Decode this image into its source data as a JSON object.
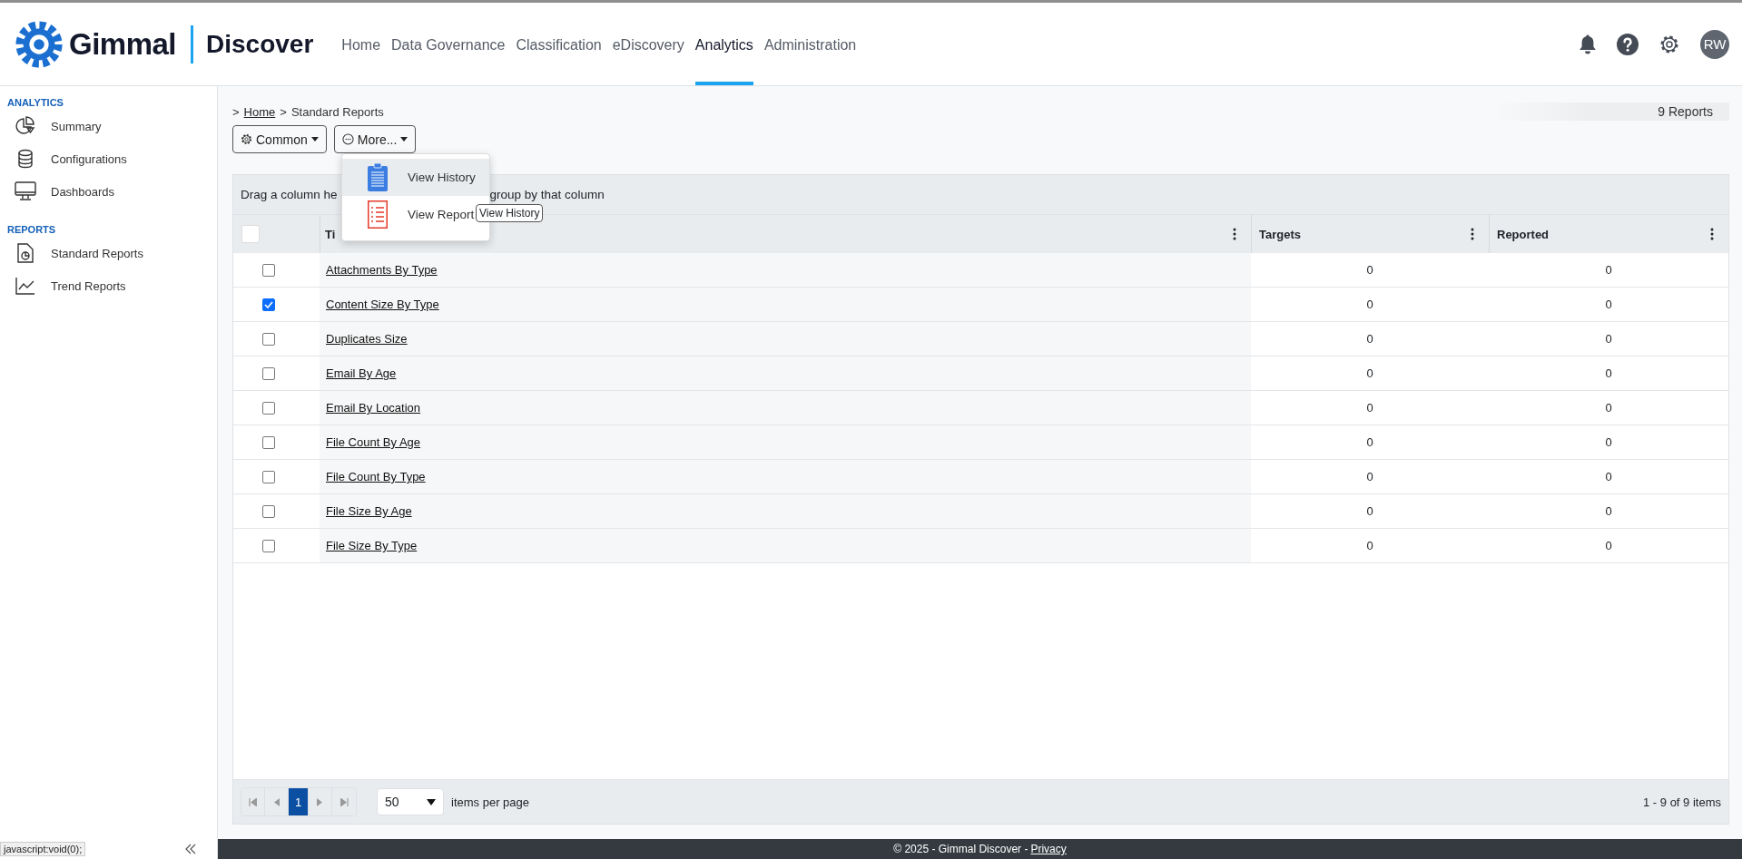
{
  "header": {
    "brand": "Gimmal",
    "product": "Discover",
    "avatar": "RW"
  },
  "nav": [
    {
      "label": "Home",
      "selected": false
    },
    {
      "label": "Data Governance",
      "selected": false
    },
    {
      "label": "Classification",
      "selected": false
    },
    {
      "label": "eDiscovery",
      "selected": false
    },
    {
      "label": "Analytics",
      "selected": true
    },
    {
      "label": "Administration",
      "selected": false
    }
  ],
  "sidebar": {
    "sections": [
      {
        "title": "ANALYTICS",
        "items": [
          {
            "label": "Summary"
          },
          {
            "label": "Configurations"
          },
          {
            "label": "Dashboards"
          }
        ]
      },
      {
        "title": "REPORTS",
        "items": [
          {
            "label": "Standard Reports"
          },
          {
            "label": "Trend Reports"
          }
        ]
      }
    ]
  },
  "breadcrumb": [
    {
      "separator": ">",
      "label": "Home",
      "link": true
    },
    {
      "separator": ">",
      "label": "Standard Reports",
      "link": false
    }
  ],
  "report_count": "9 Reports",
  "toolbar": [
    {
      "label": "Common"
    },
    {
      "label": "More..."
    }
  ],
  "menu": {
    "items": [
      {
        "label": "View History",
        "selected": true
      },
      {
        "label": "View Report",
        "selected": false
      }
    ],
    "tooltip": "View History"
  },
  "grid": {
    "group_hint": [
      "Drag a column he",
      "group by that column"
    ],
    "header_checked": false,
    "columns": [
      {
        "label": "Ti"
      },
      {
        "label": "Targets"
      },
      {
        "label": "Reported"
      }
    ],
    "rows": [
      {
        "title": "Attachments By Type",
        "targets": "0",
        "reported": "0",
        "checked": false
      },
      {
        "title": "Content Size By Type",
        "targets": "0",
        "reported": "0",
        "checked": true
      },
      {
        "title": "Duplicates Size",
        "targets": "0",
        "reported": "0",
        "checked": false
      },
      {
        "title": "Email By Age",
        "targets": "0",
        "reported": "0",
        "checked": false
      },
      {
        "title": "Email By Location",
        "targets": "0",
        "reported": "0",
        "checked": false
      },
      {
        "title": "File Count By Age",
        "targets": "0",
        "reported": "0",
        "checked": false
      },
      {
        "title": "File Count By Type",
        "targets": "0",
        "reported": "0",
        "checked": false
      },
      {
        "title": "File Size By Age",
        "targets": "0",
        "reported": "0",
        "checked": false
      },
      {
        "title": "File Size By Type",
        "targets": "0",
        "reported": "0",
        "checked": false
      }
    ],
    "pager": {
      "page": "1",
      "page_size": "50",
      "page_size_label": "items per page",
      "summary": "1 - 9 of 9 items"
    }
  },
  "footer": {
    "text": "© 2025 - Gimmal Discover - ",
    "link": "Privacy"
  },
  "status_bar": "javascript:void(0);"
}
